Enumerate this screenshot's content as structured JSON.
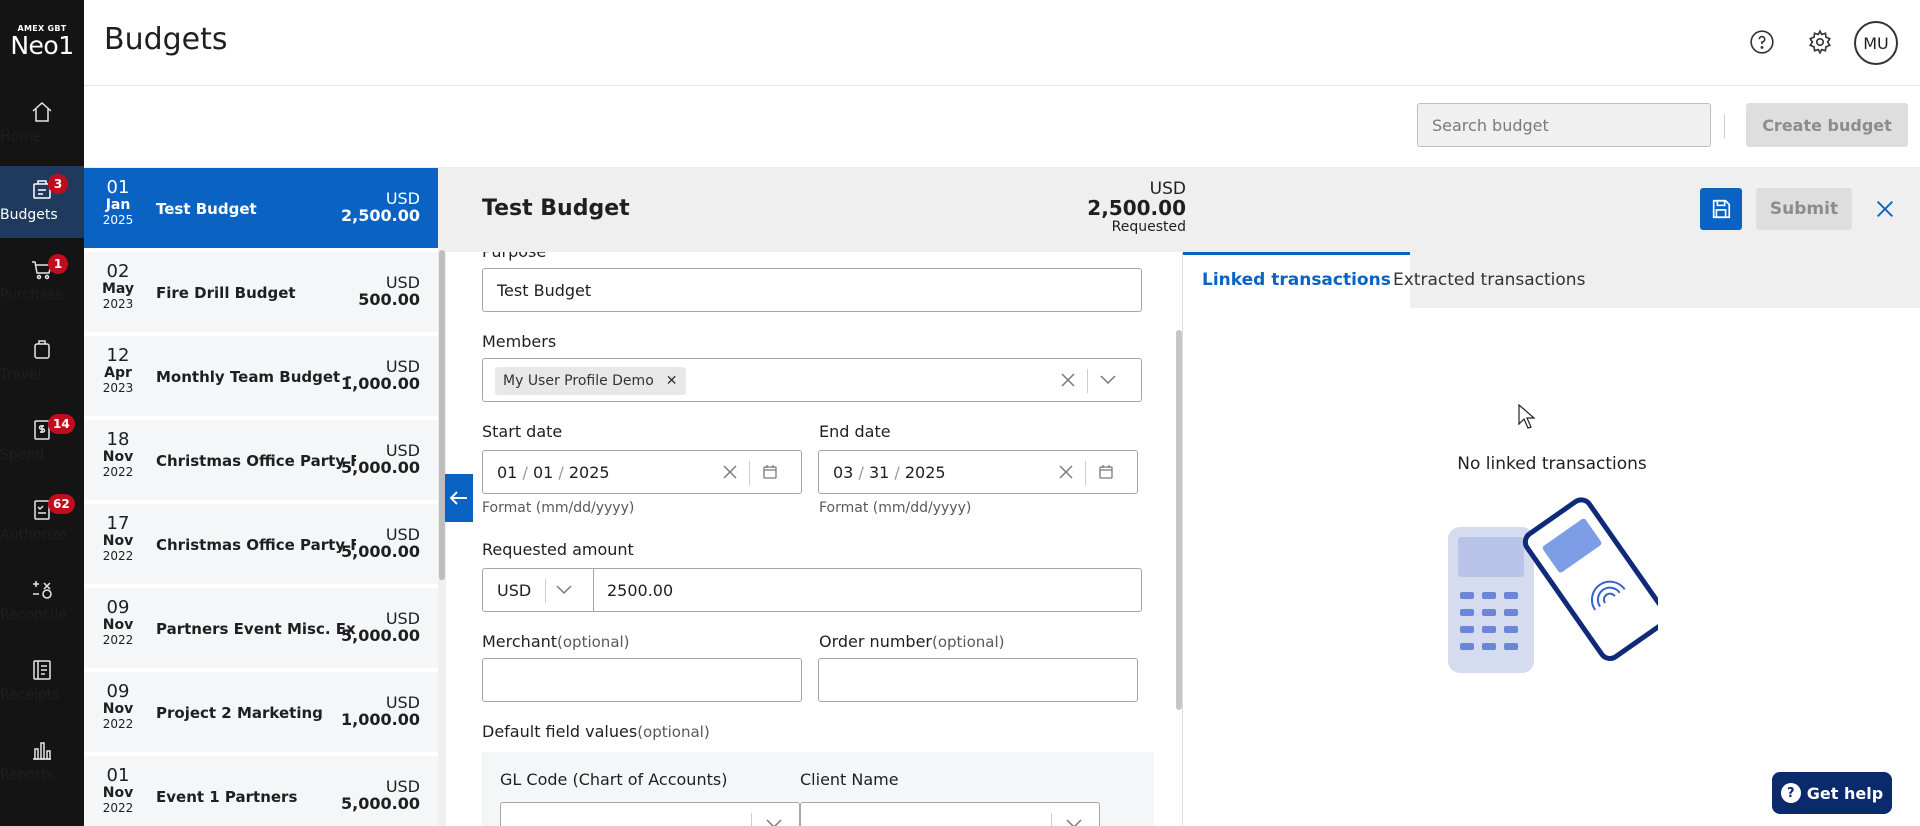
{
  "rail": {
    "logo_small": "AMEX GBT",
    "logo_big": "Neo1",
    "items": [
      {
        "label": "Home",
        "icon": "home-icon"
      },
      {
        "label": "Budgets",
        "icon": "budgets-icon",
        "badge": "3"
      },
      {
        "label": "Purchase",
        "icon": "cart-icon",
        "badge": "1"
      },
      {
        "label": "Travel",
        "icon": "luggage-icon"
      },
      {
        "label": "Spend",
        "icon": "receipt-dollar-icon",
        "badge": "14"
      },
      {
        "label": "Authorize",
        "icon": "checklist-icon",
        "badge": "62"
      },
      {
        "label": "Reconcile",
        "icon": "reconcile-icon"
      },
      {
        "label": "Receipts",
        "icon": "receipts-icon"
      },
      {
        "label": "Reports",
        "icon": "bar-chart-icon"
      }
    ]
  },
  "header": {
    "title": "Budgets",
    "avatar": "MU"
  },
  "toolbar": {
    "search_placeholder": "Search budget",
    "create_label": "Create budget"
  },
  "budgets": [
    {
      "day": "01",
      "month": "Jan",
      "year": "2025",
      "name": "Test Budget",
      "currency": "USD",
      "amount": "2,500.00",
      "selected": true
    },
    {
      "day": "02",
      "month": "May",
      "year": "2023",
      "name": "Fire Drill Budget",
      "currency": "USD",
      "amount": "500.00"
    },
    {
      "day": "12",
      "month": "Apr",
      "year": "2023",
      "name": "Monthly Team Budget - Apri",
      "currency": "USD",
      "amount": "1,000.00"
    },
    {
      "day": "18",
      "month": "Nov",
      "year": "2022",
      "name": "Christmas Office Party Fooc",
      "currency": "USD",
      "amount": "5,000.00"
    },
    {
      "day": "17",
      "month": "Nov",
      "year": "2022",
      "name": "Christmas Office Party Fooc",
      "currency": "USD",
      "amount": "5,000.00"
    },
    {
      "day": "09",
      "month": "Nov",
      "year": "2022",
      "name": "Partners Event Misc. Exp",
      "currency": "USD",
      "amount": "5,000.00"
    },
    {
      "day": "09",
      "month": "Nov",
      "year": "2022",
      "name": "Project 2 Marketing",
      "currency": "USD",
      "amount": "1,000.00"
    },
    {
      "day": "01",
      "month": "Nov",
      "year": "2022",
      "name": "Event 1 Partners",
      "currency": "USD",
      "amount": "5,000.00"
    }
  ],
  "detail": {
    "title": "Test Budget",
    "currency": "USD",
    "amount": "2,500.00",
    "status": "Requested",
    "submit_label": "Submit"
  },
  "form": {
    "purpose_label": "Purpose",
    "purpose_value": "Test Budget",
    "members_label": "Members",
    "member_chip": "My User Profile Demo",
    "start_label": "Start date",
    "start_mm": "01",
    "start_dd": "01",
    "start_yyyy": "2025",
    "end_label": "End date",
    "end_mm": "03",
    "end_dd": "31",
    "end_yyyy": "2025",
    "format_hint": "Format (mm/dd/yyyy)",
    "amount_label": "Requested amount",
    "amount_currency": "USD",
    "amount_value": "2500.00",
    "merchant_label": "Merchant",
    "order_label": "Order number",
    "optional": "(optional)",
    "defaults_label": "Default field values",
    "gl_label": "GL Code (Chart of Accounts)",
    "client_label": "Client Name"
  },
  "right": {
    "tab_linked": "Linked transactions",
    "tab_extracted": "Extracted transactions",
    "empty": "No linked transactions"
  },
  "help": {
    "label": "Get help"
  },
  "colors": {
    "primary": "#0a63c2",
    "rail": "#141414",
    "badge": "#c00d1e",
    "help": "#0b2a6b"
  }
}
